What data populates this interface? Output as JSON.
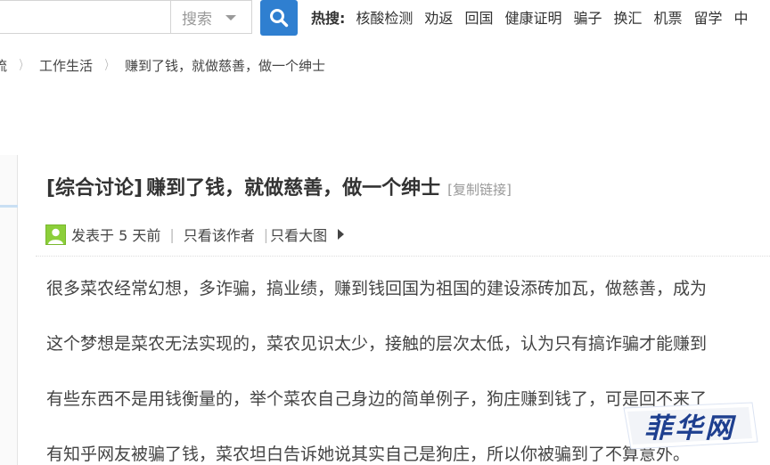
{
  "search": {
    "select_label": "搜索",
    "hot_label": "热搜:",
    "hot_items": [
      "核酸检测",
      "劝返",
      "回国",
      "健康证明",
      "骗子",
      "换汇",
      "机票",
      "留学",
      "中"
    ]
  },
  "breadcrumb": {
    "items": [
      "流",
      "工作生活",
      "赚到了钱，就做慈善，做一个绅士"
    ]
  },
  "post": {
    "category": "[综合讨论]",
    "title": "赚到了钱，就做慈善，做一个绅士",
    "copy_link": "[复制链接]",
    "meta": {
      "posted": "发表于 5 天前",
      "sep": "|",
      "author_only": "只看该作者",
      "big_image": "只看大图"
    },
    "paragraphs": [
      "很多菜农经常幻想，多诈骗，搞业绩，赚到钱回国为祖国的建设添砖加瓦，做慈善，成为",
      "这个梦想是菜农无法实现的，菜农见识太少，接触的层次太低，认为只有搞诈骗才能赚到",
      "有些东西不是用钱衡量的，举个菜农自己身边的简单例子，狗庄赚到钱了，可是回不来了",
      "有知乎网友被骗了钱，菜农坦白告诉她说其实自己是狗庄，所以你被骗到了不算意外。"
    ]
  },
  "watermark": {
    "text": "菲华网",
    "color": "#1e3f8f"
  },
  "colors": {
    "search_button": "#2f7fd0",
    "avatar": "#8ccf3a"
  }
}
